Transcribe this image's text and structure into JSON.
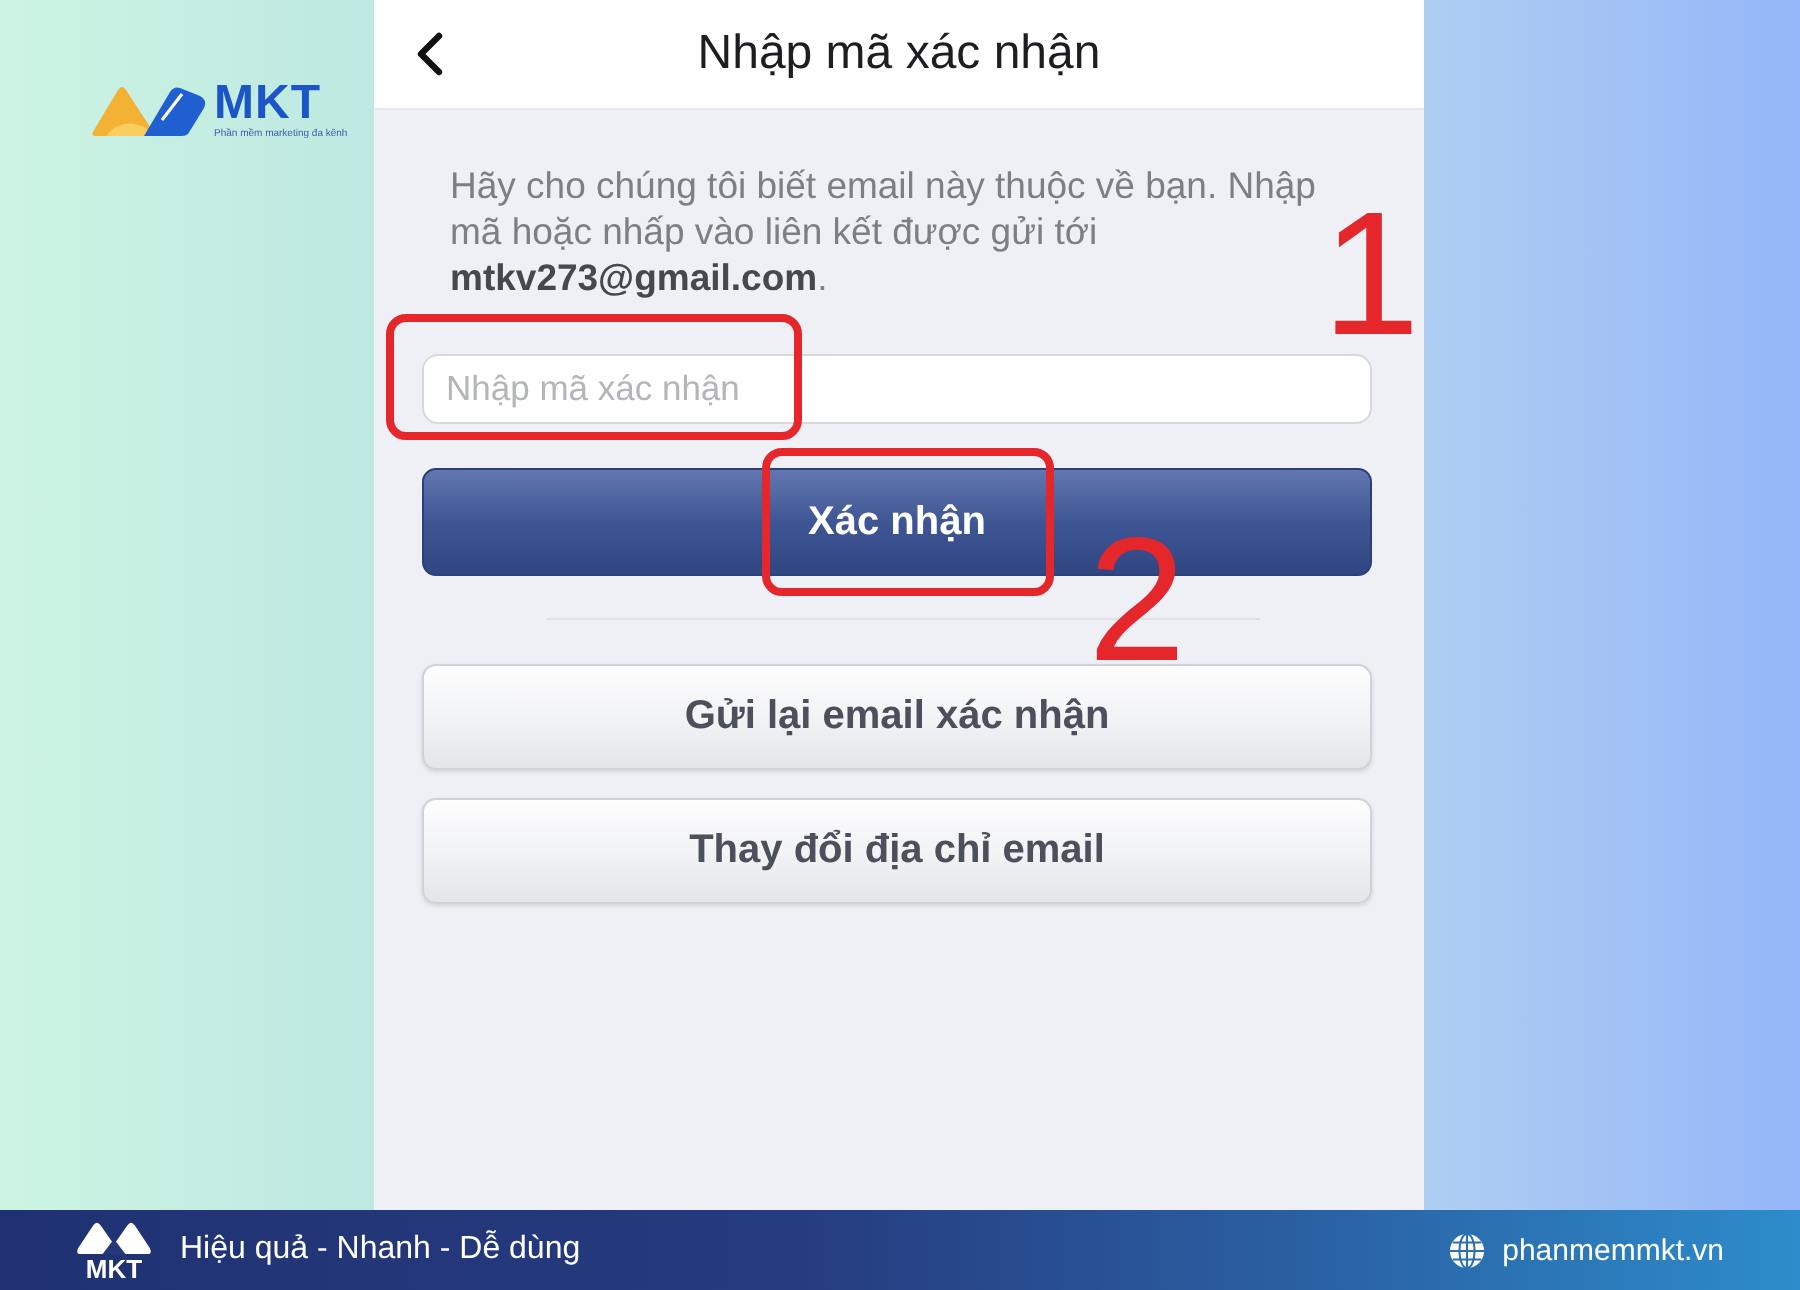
{
  "brand": {
    "name": "MKT",
    "tagline": "Phần mềm marketing đa kênh"
  },
  "screen": {
    "title": "Nhập mã xác nhận",
    "description": "Hãy cho chúng tôi biết email này thuộc về bạn. Nhập\nmã hoặc nhấp vào liên kết được gửi tới\n**mtkv273@gmail.com**.",
    "code_field": {
      "placeholder": "Nhập mã xác nhận",
      "annotation": "1"
    },
    "buttons": [
      {
        "label": "Xác nhận",
        "kind": "primary",
        "annotation": "2"
      },
      {
        "label": "Gửi lại email xác nhận",
        "kind": "secondary"
      },
      {
        "label": "Thay đổi địa chỉ email",
        "kind": "secondary"
      }
    ]
  },
  "footer": {
    "logo_text": "MKT",
    "slogan": "Hiệu quả - Nhanh - Dễ dùng",
    "website": "phanmemmkt.vn"
  }
}
